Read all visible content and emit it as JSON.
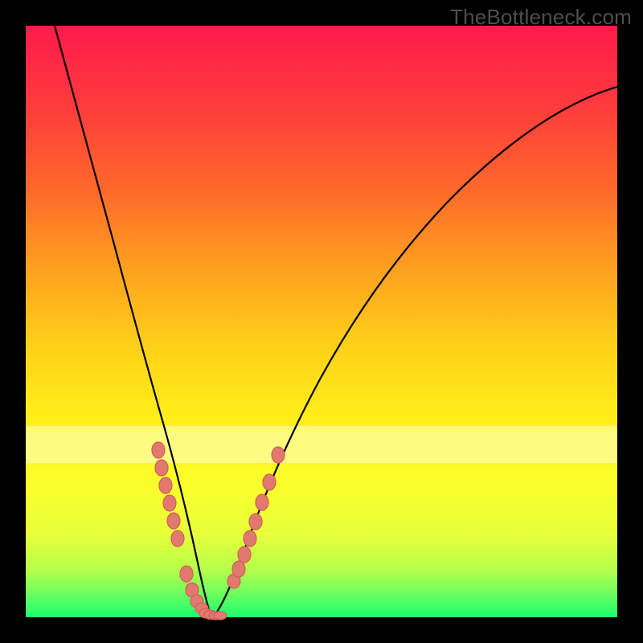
{
  "watermark": "TheBottleneck.com",
  "chart_data": {
    "type": "line",
    "title": "",
    "xlabel": "",
    "ylabel": "",
    "xlim": [
      0,
      100
    ],
    "ylim": [
      0,
      100
    ],
    "highlight_band": {
      "y_from": 66,
      "y_to": 72
    },
    "series": [
      {
        "name": "left-curve",
        "x": [
          5,
          8,
          11,
          14,
          17,
          19,
          21,
          23,
          24.5,
          26,
          27.5,
          28.5,
          29.2,
          30
        ],
        "y": [
          100,
          88,
          76,
          64,
          52,
          42,
          33,
          24,
          17,
          11,
          6,
          3,
          1,
          0
        ]
      },
      {
        "name": "right-curve",
        "x": [
          30,
          32,
          35,
          38.5,
          43,
          48,
          54,
          61,
          69,
          78,
          88,
          100
        ],
        "y": [
          0,
          2,
          7,
          14,
          23,
          33,
          44,
          55,
          65,
          73,
          79,
          83
        ]
      }
    ],
    "left_markers": {
      "x": [
        22.2,
        22.7,
        23.3,
        24.0,
        24.8,
        25.5,
        27.0,
        28.0,
        28.8,
        29.6,
        30.2,
        31.0,
        31.8,
        32.4
      ],
      "y": [
        28,
        25,
        22,
        19,
        16,
        13,
        7,
        4.5,
        2.7,
        1.4,
        0.7,
        0.4,
        0.3,
        0.3
      ]
    },
    "right_markers": {
      "x": [
        34.6,
        35.4,
        36.3,
        37.2,
        38.1,
        39.2,
        40.4,
        42.0
      ],
      "y": [
        6,
        8,
        10.6,
        13.4,
        16.2,
        19.4,
        22.8,
        27.4
      ]
    }
  }
}
